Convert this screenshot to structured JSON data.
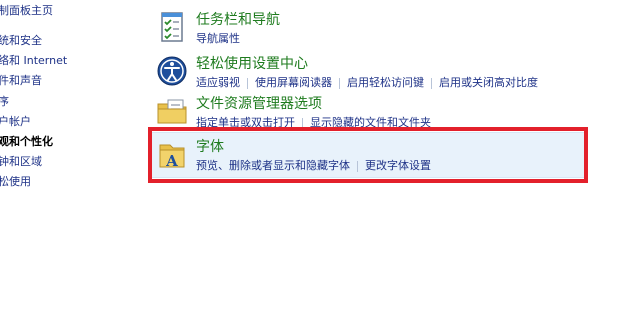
{
  "sidebar": {
    "items": [
      {
        "label": "制面板主页",
        "current": false
      },
      {
        "label": "统和安全",
        "current": false
      },
      {
        "label": "络和 Internet",
        "current": false
      },
      {
        "label": "件和声音",
        "current": false
      },
      {
        "label": "序",
        "current": false
      },
      {
        "label": "户帐户",
        "current": false
      },
      {
        "label": "观和个性化",
        "current": true
      },
      {
        "label": "钟和区域",
        "current": false
      },
      {
        "label": "松使用",
        "current": false
      }
    ]
  },
  "categories": [
    {
      "title": "任务栏和导航",
      "icon": "taskbar-checklist-icon",
      "links": [
        "导航属性"
      ]
    },
    {
      "title": "轻松使用设置中心",
      "icon": "ease-of-access-icon",
      "links": [
        "适应弱视",
        "使用屏幕阅读器",
        "启用轻松访问键",
        "启用或关闭高对比度"
      ]
    },
    {
      "title": "文件资源管理器选项",
      "icon": "folder-options-icon",
      "links": [
        "指定单击或双击打开",
        "显示隐藏的文件和文件夹"
      ]
    },
    {
      "title": "字体",
      "icon": "fonts-folder-icon",
      "links": [
        "预览、删除或者显示和隐藏字体",
        "更改字体设置"
      ],
      "highlighted": true
    }
  ],
  "colors": {
    "link": "#1e3287",
    "category_title": "#1e7b1e",
    "highlight_bg": "#e8f2fb",
    "annotation_box": "#e3202b"
  }
}
